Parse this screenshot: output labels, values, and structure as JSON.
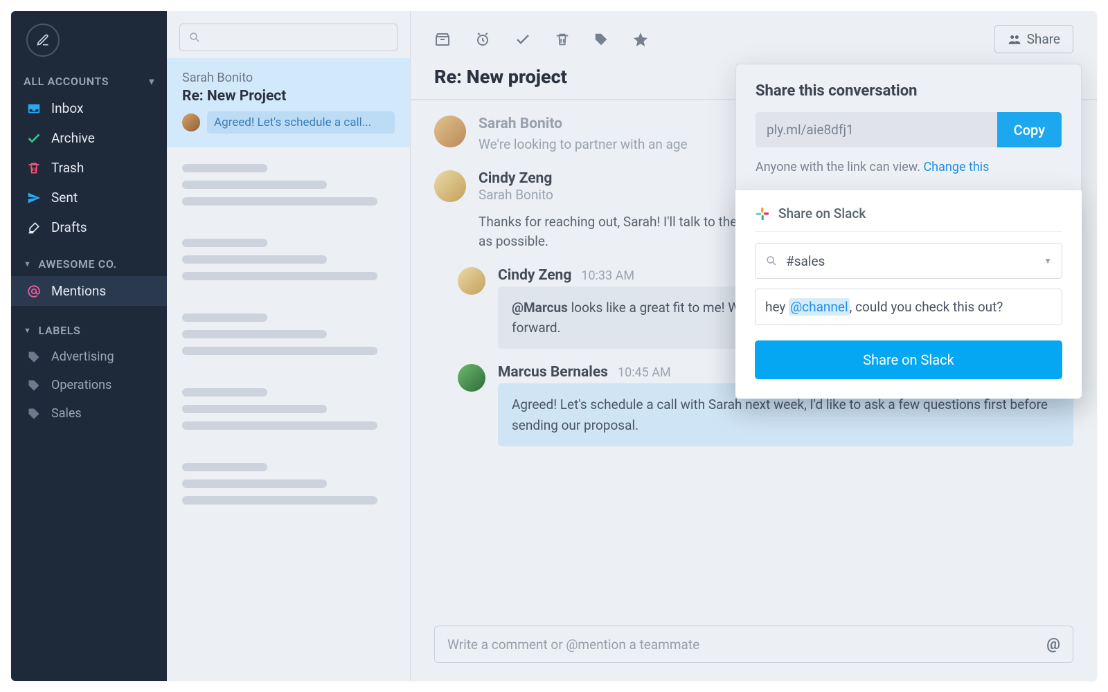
{
  "sidebar": {
    "section_accounts": "ALL ACCOUNTS",
    "items": {
      "inbox": "Inbox",
      "archive": "Archive",
      "trash": "Trash",
      "sent": "Sent",
      "drafts": "Drafts"
    },
    "section_org": "AWESOME CO.",
    "mentions": "Mentions",
    "section_labels": "LABELS",
    "labels": [
      "Advertising",
      "Operations",
      "Sales"
    ]
  },
  "threadlist": {
    "selected": {
      "sender": "Sarah Bonito",
      "subject": "Re:  New Project",
      "preview": "Agreed! Let's schedule a call..."
    }
  },
  "conversation": {
    "subject": "Re: New project",
    "share_button": "Share",
    "messages": {
      "m0": {
        "name": "Sarah Bonito",
        "snippet": "We're looking to partner with an age"
      },
      "m1": {
        "name": "Cindy Zeng",
        "subname": "Sarah Bonito",
        "text": "Thanks for reaching out, Sarah! I'll talk to the team and get you an outline, timeline and pricing as soon as possible."
      },
      "m2": {
        "name": "Cindy Zeng",
        "time": "10:33 AM",
        "bubble_mention": "@Marcus",
        "bubble_rest": " looks like a great fit to me! We should talk through the outline before moving forward."
      },
      "m3": {
        "name": "Marcus Bernales",
        "time": "10:45 AM",
        "bubble": "Agreed! Let's schedule a call with Sarah next week, I'd like to ask a few questions first before sending our proposal."
      }
    },
    "comment_placeholder": "Write a comment or @mention a teammate"
  },
  "popover": {
    "title": "Share this conversation",
    "link": "ply.ml/aie8dfj1",
    "copy": "Copy",
    "note_text": "Anyone with the link can view. ",
    "note_link": "Change this",
    "slack": {
      "title": "Share on Slack",
      "channel": "#sales",
      "msg_pre": "hey ",
      "msg_mention": "@channel",
      "msg_post": ", could you check this out?",
      "button": "Share on Slack"
    }
  }
}
